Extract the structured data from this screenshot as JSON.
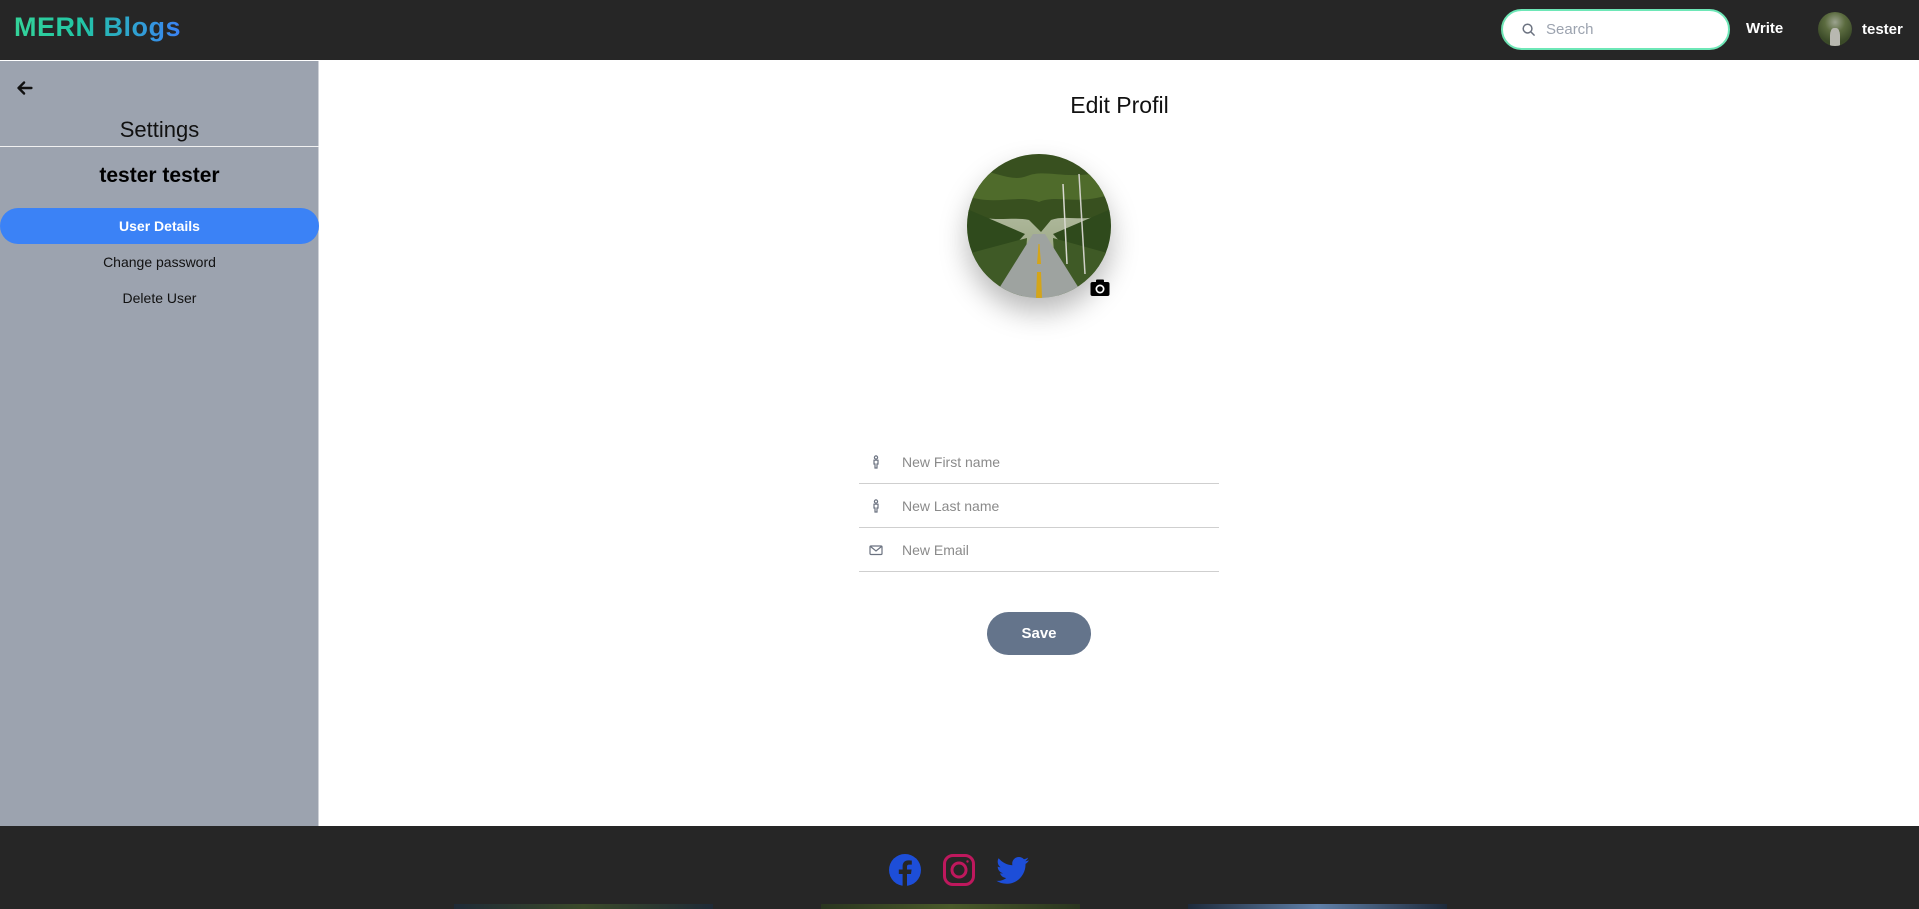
{
  "navbar": {
    "brand": "MERN Blogs",
    "search": {
      "placeholder": "Search",
      "value": ""
    },
    "write_label": "Write",
    "username": "tester"
  },
  "sidebar": {
    "title": "Settings",
    "username": "tester tester",
    "items": [
      {
        "label": "User Details",
        "active": true
      },
      {
        "label": "Change password",
        "active": false
      },
      {
        "label": "Delete User",
        "active": false
      }
    ]
  },
  "main": {
    "title": "Edit Profil",
    "fields": [
      {
        "icon": "person-icon",
        "placeholder": "New First name",
        "value": ""
      },
      {
        "icon": "person-icon",
        "placeholder": "New Last name",
        "value": ""
      },
      {
        "icon": "mail-icon",
        "placeholder": "New Email",
        "value": ""
      }
    ],
    "save_label": "Save"
  },
  "footer": {
    "social": [
      "facebook-icon",
      "instagram-icon",
      "twitter-icon"
    ]
  },
  "colors": {
    "navbar_bg": "#262626",
    "sidebar_bg": "#9ca3af",
    "active_item": "#3b82f6",
    "save_button": "#64748b",
    "search_border": "#6ee7b7",
    "facebook": "#1d4ed8",
    "instagram": "#be185d",
    "twitter": "#1d4ed8"
  }
}
